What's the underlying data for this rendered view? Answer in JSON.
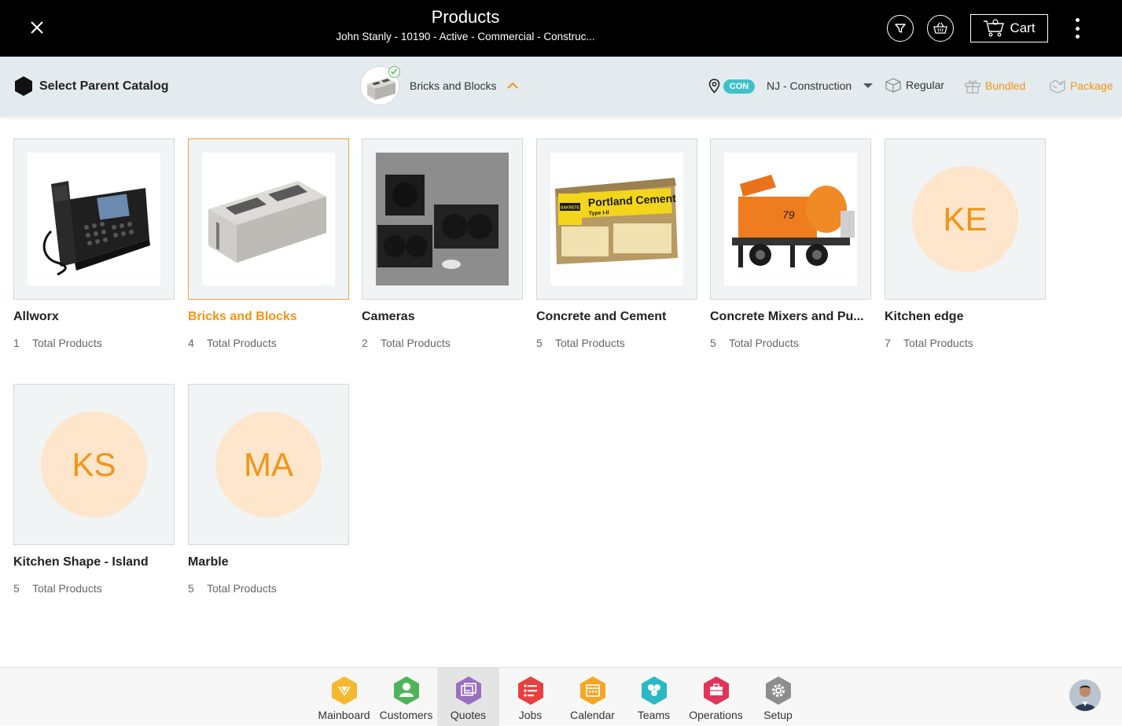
{
  "header": {
    "title": "Products",
    "subtitle": "John Stanly - 10190 - Active - Commercial - Construc...",
    "cart_label": "Cart"
  },
  "subbar": {
    "parent_catalog_label": "Select Parent Catalog",
    "selected_catalog": "Bricks and Blocks",
    "location_badge": "CON",
    "location": "NJ - Construction",
    "modes": {
      "regular": "Regular",
      "bundled": "Bundled",
      "package": "Package"
    }
  },
  "catalogs": [
    {
      "name": "Allworx",
      "count": "1",
      "count_label": "Total Products",
      "image": "desk-phone",
      "active": false
    },
    {
      "name": "Bricks and Blocks",
      "count": "4",
      "count_label": "Total Products",
      "image": "cinder-block",
      "active": true
    },
    {
      "name": "Cameras",
      "count": "2",
      "count_label": "Total Products",
      "image": "speakers",
      "active": false
    },
    {
      "name": "Concrete and Cement",
      "count": "5",
      "count_label": "Total Products",
      "image": "cement-bag",
      "active": false
    },
    {
      "name": "Concrete Mixers and Pu...",
      "count": "5",
      "count_label": "Total Products",
      "image": "concrete-mixer",
      "active": false
    },
    {
      "name": "Kitchen edge",
      "count": "7",
      "count_label": "Total Products",
      "initials": "KE",
      "active": false
    },
    {
      "name": "Kitchen Shape - Island",
      "count": "5",
      "count_label": "Total Products",
      "initials": "KS",
      "active": false
    },
    {
      "name": "Marble",
      "count": "5",
      "count_label": "Total Products",
      "initials": "MA",
      "active": false
    }
  ],
  "cement_bag_text": "Portland Cement",
  "cement_bag_subtext": "Type I-II",
  "cement_bag_brand": "SAKRETE",
  "mixer_number": "79",
  "nav": [
    {
      "label": "Mainboard",
      "color": "#f5b82e",
      "icon": "mainboard-icon"
    },
    {
      "label": "Customers",
      "color": "#4fb35a",
      "icon": "customers-icon"
    },
    {
      "label": "Quotes",
      "color": "#9a6fc0",
      "icon": "quotes-icon",
      "active": true
    },
    {
      "label": "Jobs",
      "color": "#e84040",
      "icon": "jobs-icon"
    },
    {
      "label": "Calendar",
      "color": "#f5a623",
      "icon": "calendar-icon"
    },
    {
      "label": "Teams",
      "color": "#2bb8c4",
      "icon": "teams-icon"
    },
    {
      "label": "Operations",
      "color": "#e0345a",
      "icon": "operations-icon"
    },
    {
      "label": "Setup",
      "color": "#8e8e8e",
      "icon": "setup-icon"
    }
  ],
  "colors": {
    "accent": "#f39416",
    "header_bg": "#000000",
    "subbar_bg": "#e4ebee",
    "badge": "#3fc1c9"
  }
}
